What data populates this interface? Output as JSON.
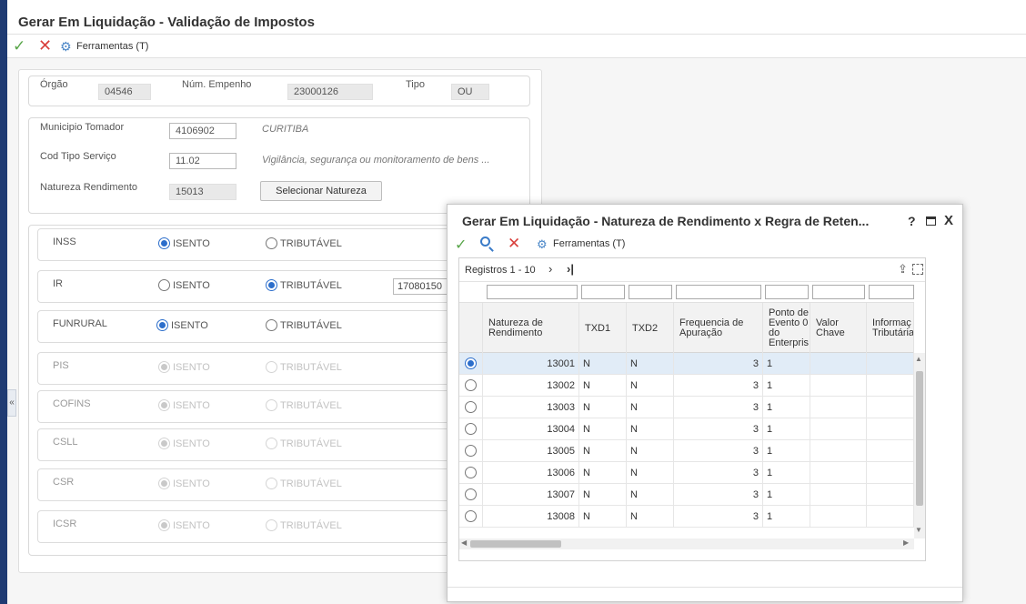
{
  "main": {
    "title": "Gerar Em Liquidação - Validação de Impostos",
    "toolbar": {
      "tools_label": "Ferramentas (T)"
    }
  },
  "header_fields": {
    "orgao_label": "Órgão",
    "orgao_value": "04546",
    "empenho_label": "Núm. Empenho",
    "empenho_value": "23000126",
    "tipo_label": "Tipo",
    "tipo_value": "OU"
  },
  "service": {
    "municipio_label": "Municipio Tomador",
    "municipio_value": "4106902",
    "municipio_desc": "CURITIBA",
    "cod_label": "Cod Tipo Serviço",
    "cod_value": "11.02",
    "cod_desc": "Vigilância, segurança ou monitoramento de bens ...",
    "natureza_label": "Natureza Rendimento",
    "natureza_value": "15013",
    "selecionar_label": "Selecionar Natureza"
  },
  "taxes": [
    {
      "name": "INSS",
      "isento": "ISENTO",
      "tributavel": "TRIBUTÁVEL",
      "selected": "isento",
      "enabled": true
    },
    {
      "name": "IR",
      "isento": "ISENTO",
      "tributavel": "TRIBUTÁVEL",
      "selected": "tributavel",
      "enabled": true,
      "field": "17080150"
    },
    {
      "name": "FUNRURAL",
      "isento": "ISENTO",
      "tributavel": "TRIBUTÁVEL",
      "selected": "isento",
      "enabled": true
    },
    {
      "name": "PIS",
      "isento": "ISENTO",
      "tributavel": "TRIBUTÁVEL",
      "selected": "isento",
      "enabled": false
    },
    {
      "name": "COFINS",
      "isento": "ISENTO",
      "tributavel": "TRIBUTÁVEL",
      "selected": "isento",
      "enabled": false
    },
    {
      "name": "CSLL",
      "isento": "ISENTO",
      "tributavel": "TRIBUTÁVEL",
      "selected": "isento",
      "enabled": false
    },
    {
      "name": "CSR",
      "isento": "ISENTO",
      "tributavel": "TRIBUTÁVEL",
      "selected": "isento",
      "enabled": false
    },
    {
      "name": "ICSR",
      "isento": "ISENTO",
      "tributavel": "TRIBUTÁVEL",
      "selected": "isento",
      "enabled": false
    }
  ],
  "modal": {
    "title": "Gerar Em Liquidação - Natureza de Rendimento x Regra de Reten...",
    "help": "?",
    "close": "X",
    "tools_label": "Ferramentas (T)",
    "registros": "Registros 1 - 10",
    "columns": [
      "Natureza de Rendimento",
      "TXD1",
      "TXD2",
      "Frequencia de Apuração",
      "Ponto de Evento 0 do Enterpris",
      "Valor Chave",
      "Informaç Tributária"
    ],
    "rows": [
      {
        "natureza": "13001",
        "txd1": "N",
        "txd2": "N",
        "freq": "3",
        "ponto": "1",
        "selected": true
      },
      {
        "natureza": "13002",
        "txd1": "N",
        "txd2": "N",
        "freq": "3",
        "ponto": "1",
        "selected": false
      },
      {
        "natureza": "13003",
        "txd1": "N",
        "txd2": "N",
        "freq": "3",
        "ponto": "1",
        "selected": false
      },
      {
        "natureza": "13004",
        "txd1": "N",
        "txd2": "N",
        "freq": "3",
        "ponto": "1",
        "selected": false
      },
      {
        "natureza": "13005",
        "txd1": "N",
        "txd2": "N",
        "freq": "3",
        "ponto": "1",
        "selected": false
      },
      {
        "natureza": "13006",
        "txd1": "N",
        "txd2": "N",
        "freq": "3",
        "ponto": "1",
        "selected": false
      },
      {
        "natureza": "13007",
        "txd1": "N",
        "txd2": "N",
        "freq": "3",
        "ponto": "1",
        "selected": false
      },
      {
        "natureza": "13008",
        "txd1": "N",
        "txd2": "N",
        "freq": "3",
        "ponto": "1",
        "selected": false
      }
    ]
  }
}
